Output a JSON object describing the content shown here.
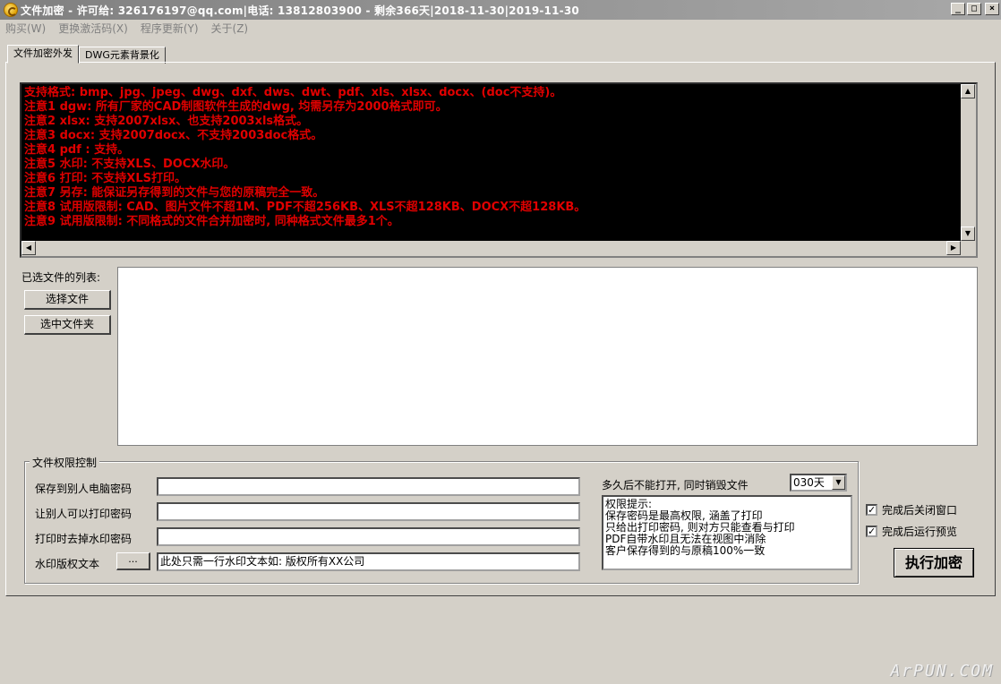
{
  "window": {
    "title": "文件加密 - 许可给: 326176197@qq.com|电话: 13812803900 - 剩余366天|2018-11-30|2019-11-30",
    "icon": "app-lock-icon",
    "minimize": "_",
    "maximize": "□",
    "close": "×"
  },
  "menu": [
    "购买(W)",
    "更换激活码(X)",
    "程序更新(Y)",
    "关于(Z)"
  ],
  "tabs": [
    "文件加密外发",
    "DWG元素背景化"
  ],
  "notes": [
    "支持格式: bmp、jpg、jpeg、dwg、dxf、dws、dwt、pdf、xls、xlsx、docx、(doc不支持)。",
    "注意1 dgw: 所有厂家的CAD制图软件生成的dwg, 均需另存为2000格式即可。",
    "注意2 xlsx: 支持2007xlsx、也支持2003xls格式。",
    "注意3 docx: 支持2007docx、不支持2003doc格式。",
    "注意4 pdf : 支持。",
    "注意5 水印: 不支持XLS、DOCX水印。",
    "注意6 打印: 不支持XLS打印。",
    "注意7 另存: 能保证另存得到的文件与您的原稿完全一致。",
    "注意8 试用版限制: CAD、图片文件不超1M、PDF不超256KB、XLS不超128KB、DOCX不超128KB。",
    "注意9 试用版限制: 不同格式的文件合并加密时, 同种格式文件最多1个。"
  ],
  "file_list": {
    "label": "已选文件的列表:",
    "select_file_button": "选择文件",
    "select_folder_button": "选中文件夹"
  },
  "permissions": {
    "group_title": "文件权限控制",
    "save_password_label": "保存到别人电脑密码",
    "save_password_value": "",
    "print_password_label": "让别人可以打印密码",
    "print_password_value": "",
    "remove_watermark_label": "打印时去掉水印密码",
    "remove_watermark_value": "",
    "watermark_label": "水印版权文本",
    "watermark_browse": "...",
    "watermark_value": "此处只需一行水印文本如: 版权所有XX公司",
    "expire_label": "多久后不能打开, 同时销毁文件",
    "expire_value": "030天",
    "hint_lines": [
      "权限提示:",
      "保存密码是最高权限, 涵盖了打印",
      "只给出打印密码, 则对方只能查看与打印",
      "PDF自带水印且无法在视图中消除",
      "客户保存得到的与原稿100%一致"
    ]
  },
  "options": {
    "close_after": "完成后关闭窗口",
    "close_after_checked": true,
    "preview_after": "完成后运行预览",
    "preview_after_checked": true
  },
  "execute_button": "执行加密",
  "watermark_logo": "ArPUN.COM",
  "colors": {
    "notes_text": "#e00000",
    "notes_bg": "#000000",
    "window_bg": "#d4d0c8"
  }
}
